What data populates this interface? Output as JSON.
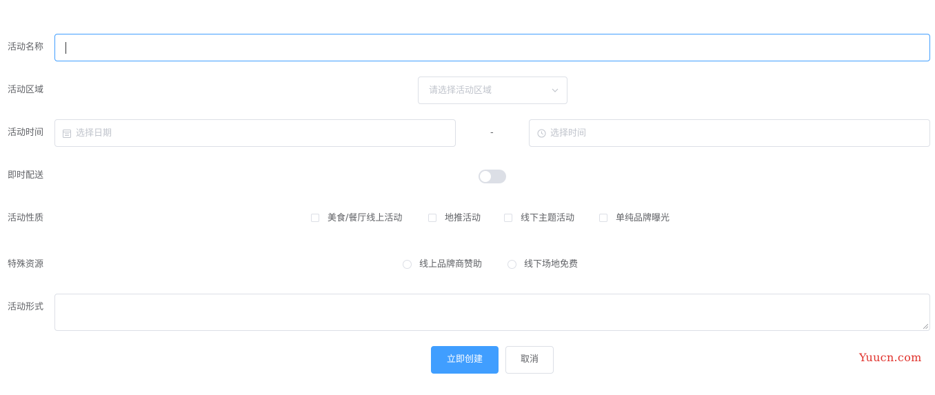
{
  "form": {
    "name": {
      "label": "活动名称",
      "value": ""
    },
    "region": {
      "label": "活动区域",
      "placeholder": "请选择活动区域"
    },
    "time": {
      "label": "活动时间",
      "date_placeholder": "选择日期",
      "separator": "-",
      "time_placeholder": "选择时间"
    },
    "delivery": {
      "label": "即时配送",
      "enabled": false
    },
    "type": {
      "label": "活动性质",
      "options": [
        "美食/餐厅线上活动",
        "地推活动",
        "线下主题活动",
        "单纯品牌曝光"
      ]
    },
    "resource": {
      "label": "特殊资源",
      "options": [
        "线上品牌商赞助",
        "线下场地免费"
      ]
    },
    "desc": {
      "label": "活动形式",
      "value": ""
    }
  },
  "actions": {
    "create_label": "立即创建",
    "cancel_label": "取消"
  },
  "watermark": "Yuucn.com",
  "icons": {
    "date": "calendar-icon",
    "time": "clock-icon",
    "select": "chevron-down-icon"
  },
  "colors": {
    "primary": "#409eff",
    "border": "#dcdfe6",
    "placeholder": "#c0c4cc",
    "text": "#606266",
    "watermark": "#e0312b"
  }
}
